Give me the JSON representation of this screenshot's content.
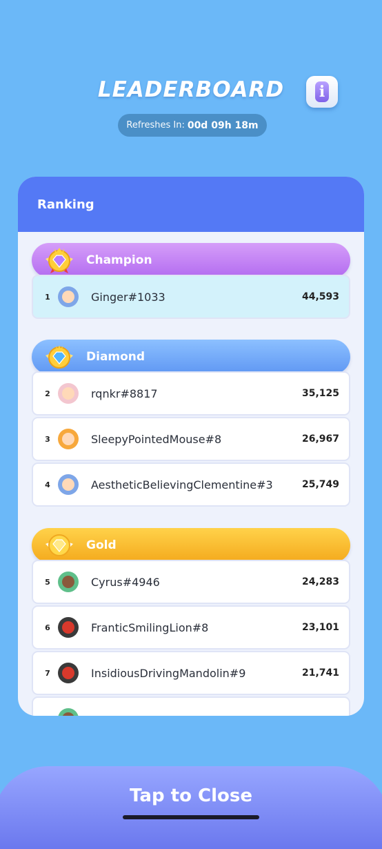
{
  "header": {
    "title": "LEADERBOARD",
    "refresh_label": "Refreshes In:",
    "refresh_time": "00d 09h 18m",
    "info_glyph": "i"
  },
  "panel": {
    "title": "Ranking"
  },
  "tiers": {
    "champion": "Champion",
    "diamond": "Diamond",
    "gold": "Gold"
  },
  "rows": [
    {
      "rank": "1",
      "name": "Ginger#1033",
      "score": "44,593",
      "avatar": "blue-hood-avatar"
    },
    {
      "rank": "2",
      "name": "rqnkr#8817",
      "score": "35,125",
      "avatar": "pink-hat-avatar"
    },
    {
      "rank": "3",
      "name": "SleepyPointedMouse#8",
      "score": "26,967",
      "avatar": "flower-avatar"
    },
    {
      "rank": "4",
      "name": "AestheticBelievingClementine#3",
      "score": "25,749",
      "avatar": "blue-hood-avatar"
    },
    {
      "rank": "5",
      "name": "Cyrus#4946",
      "score": "24,283",
      "avatar": "dino-avatar"
    },
    {
      "rank": "6",
      "name": "FranticSmilingLion#8",
      "score": "23,101",
      "avatar": "headphones-avatar"
    },
    {
      "rank": "7",
      "name": "InsidiousDrivingMandolin#9",
      "score": "21,741",
      "avatar": "headphones-avatar"
    },
    {
      "rank": "",
      "name": "",
      "score": "",
      "avatar": "dino-avatar"
    }
  ],
  "footer": {
    "close_label": "Tap to Close"
  },
  "colors": {
    "background": "#6bb8f8",
    "panel_header": "#5479f5",
    "champion": "#c384f5",
    "diamond": "#73a9f8",
    "gold": "#f8be30",
    "highlight_row": "#d3f2fb"
  }
}
